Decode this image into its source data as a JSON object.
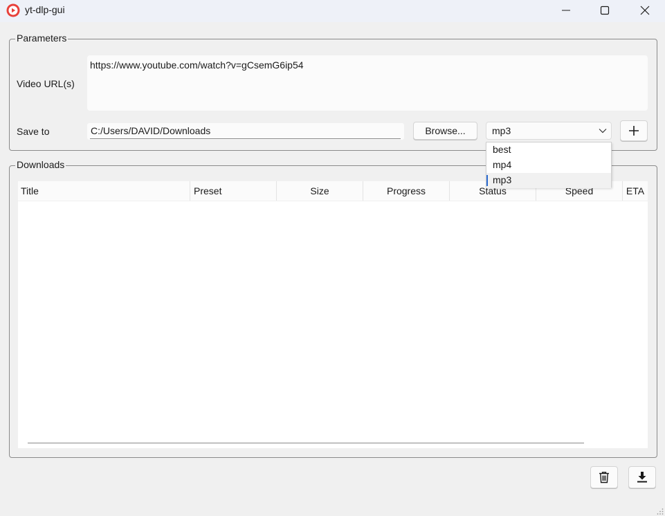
{
  "window": {
    "title": "yt-dlp-gui"
  },
  "parameters": {
    "group_label": "Parameters",
    "url_label": "Video URL(s)",
    "url_value": "https://www.youtube.com/watch?v=gCsemG6ip54",
    "save_label": "Save to",
    "save_path": "C:/Users/DAVID/Downloads",
    "browse_label": "Browse...",
    "preset_selected": "mp3",
    "preset_options": [
      "best",
      "mp4",
      "mp3"
    ]
  },
  "downloads": {
    "group_label": "Downloads",
    "columns": [
      "Title",
      "Preset",
      "Size",
      "Progress",
      "Status",
      "Speed",
      "ETA"
    ]
  },
  "colors": {
    "accent": "#2a6ad0",
    "app_icon": "#e8413b"
  }
}
